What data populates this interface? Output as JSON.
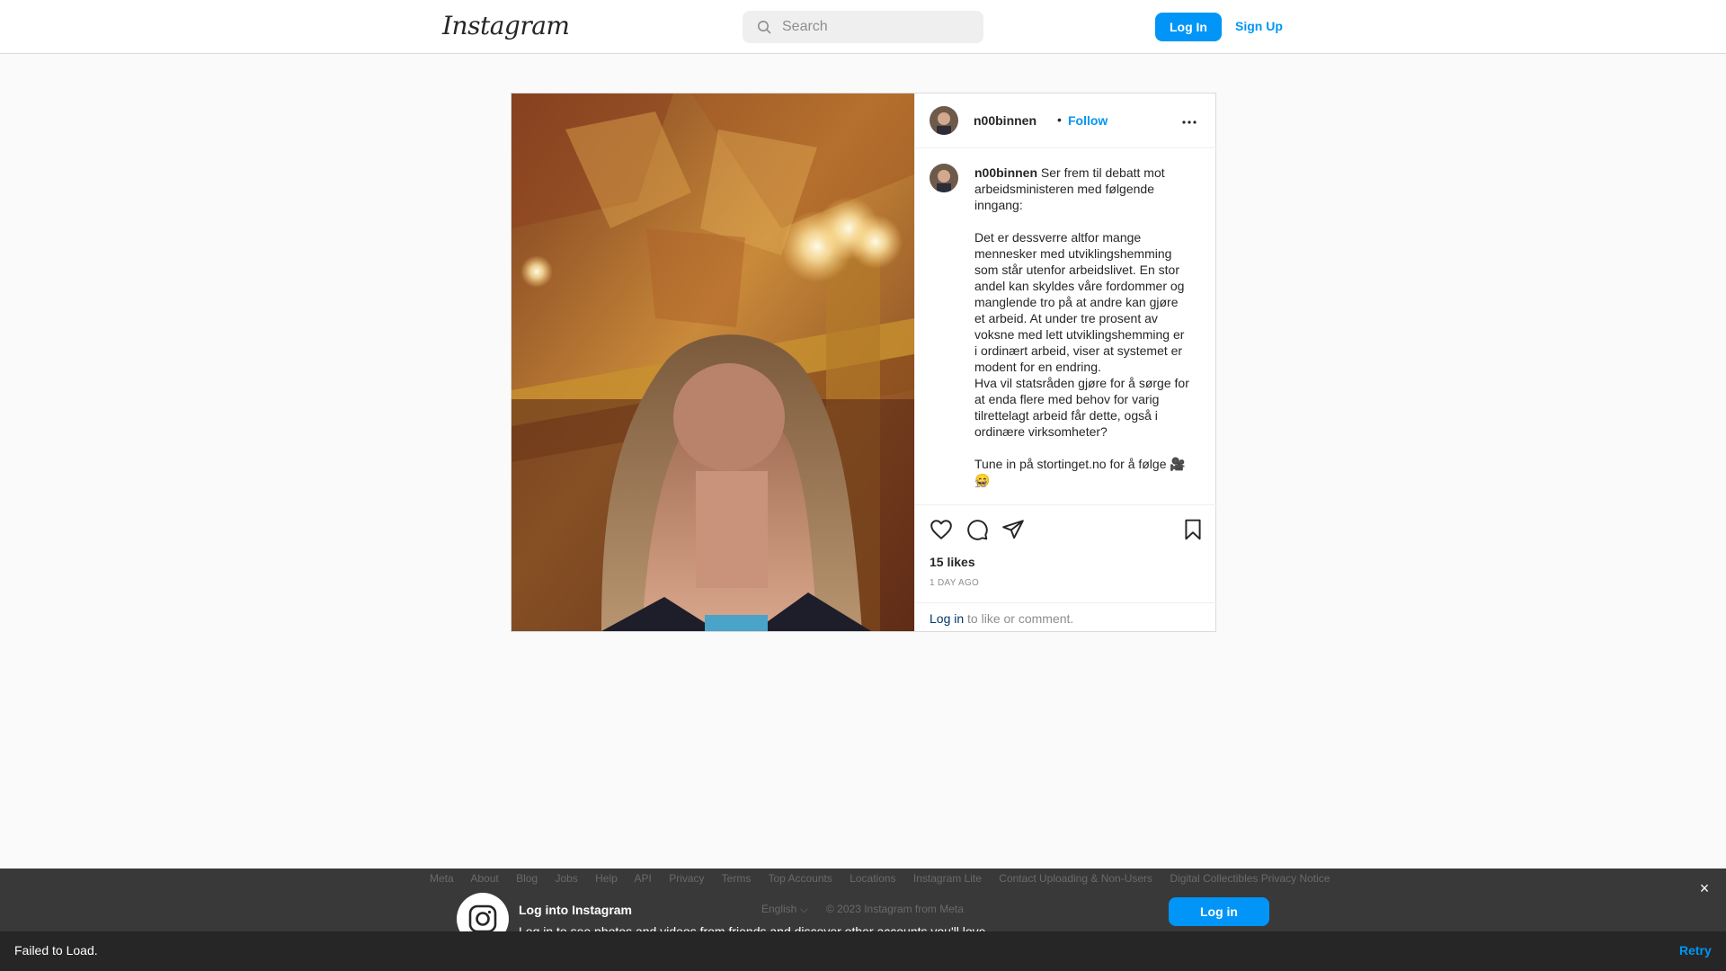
{
  "header": {
    "logo_text": "Instagram",
    "search_placeholder": "Search",
    "login_label": "Log In",
    "signup_label": "Sign Up"
  },
  "post": {
    "username": "n00binnen",
    "separator": "•",
    "follow_label": "Follow",
    "caption_user": "n00binnen",
    "caption_text": " Ser frem til debatt mot arbeidsministeren med følgende inngang:\n\nDet er dessverre altfor mange mennesker med utviklingshemming som står utenfor arbeidslivet. En stor andel kan skyldes våre fordommer og manglende tro på at andre kan gjøre et arbeid. At under tre prosent av voksne med lett utviklingshemming er i ordinært arbeid, viser at systemet er modent for en endring.\nHva vil statsråden gjøre for å sørge for at enda flere med behov for varig tilrettelagt arbeid får dette, også i ordinære virksomheter?\n\nTune in på stortinget.no for å følge 🎥😄",
    "time_short": "1d",
    "likes": "15 likes",
    "time_long": "1 DAY AGO",
    "login_link": "Log in",
    "login_rest": " to like or comment."
  },
  "icons": {
    "search": "search-icon",
    "more": "more-horizontal-icon",
    "like": "heart-icon",
    "comment": "comment-icon",
    "share": "send-icon",
    "save": "bookmark-icon",
    "instagram": "instagram-glyph-icon",
    "close": "close-icon"
  },
  "footer": {
    "links": [
      "Meta",
      "About",
      "Blog",
      "Jobs",
      "Help",
      "API",
      "Privacy",
      "Terms",
      "Top Accounts",
      "Locations",
      "Instagram Lite",
      "Contact Uploading & Non-Users",
      "Digital Collectibles Privacy Notice"
    ],
    "language": "English ⌵",
    "copyright": "© 2023 Instagram from Meta"
  },
  "login_prompt": {
    "title": "Log into Instagram",
    "subtitle": "Log in to see photos and videos from friends and discover other accounts you'll love.",
    "button_label": "Log in",
    "close_label": "×"
  },
  "failbar": {
    "message": "Failed to Load.",
    "retry_label": "Retry"
  },
  "colors": {
    "accent": "#0095f6",
    "border": "#dbdbdb",
    "muted": "#8e8e8e"
  }
}
